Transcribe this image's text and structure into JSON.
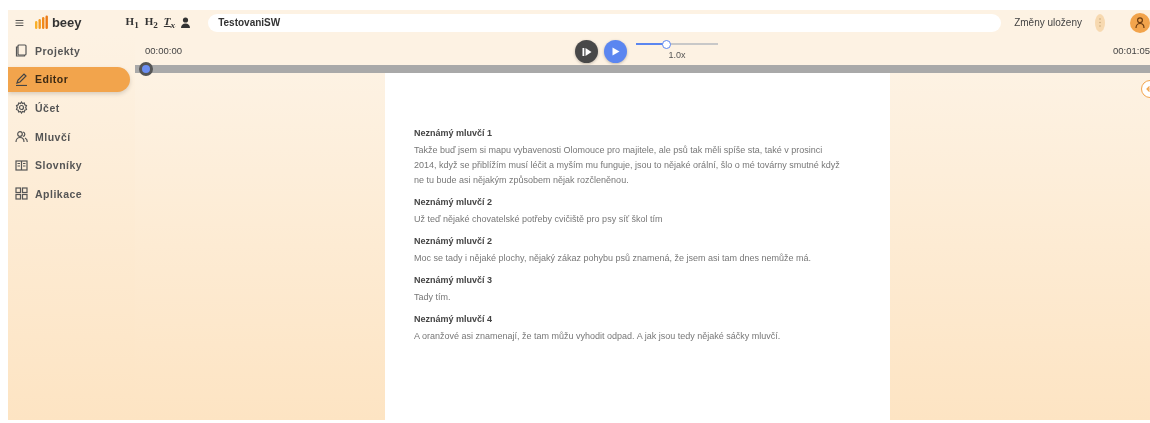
{
  "header": {
    "brand": "beey",
    "tools": [
      "H",
      "H",
      "T"
    ],
    "tool_subs": [
      "1",
      "2",
      "x"
    ],
    "title_value": "TestovaniSW",
    "save_status": "Změny uloženy"
  },
  "sidebar": {
    "items": [
      {
        "label": "Projekty",
        "selected": false
      },
      {
        "label": "Editor",
        "selected": true
      },
      {
        "label": "Účet",
        "selected": false
      },
      {
        "label": "Mluvčí",
        "selected": false
      },
      {
        "label": "Slovníky",
        "selected": false
      },
      {
        "label": "Aplikace",
        "selected": false
      }
    ]
  },
  "player": {
    "current_time": "00:00:00",
    "total_time": "00:01:05",
    "speed": {
      "level": 0.38,
      "reading": "1.0x"
    },
    "timeline": {
      "level": 0
    }
  },
  "transcript": [
    {
      "speaker": "Neznámý mluvčí 1",
      "text": "Takže buď jsem si mapu vybavenosti Olomouce pro majitele, ale psů tak měli spíše sta, také v prosinci 2014, když se přiblížím musí léčit a myším mu funguje, jsou to nějaké orální, šlo o mé továrny smutné když ne tu bude asi nějakým způsobem nějak rozčleněnou."
    },
    {
      "speaker": "Neznámý mluvčí 2",
      "text": "Už teď nějaké chovatelské potřeby cvičiště pro psy síť škol tím"
    },
    {
      "speaker": "Neznámý mluvčí 2",
      "text": "Moc se tady i nějaké plochy, nějaký zákaz pohybu psů znamená, že jsem asi tam dnes nemůže má."
    },
    {
      "speaker": "Neznámý mluvčí 3",
      "text": "Tady tím."
    },
    {
      "speaker": "Neznámý mluvčí 4",
      "text": "A oranžové asi znamenají, že tam můžu vyhodit odpad. A jak jsou tedy nějaké sáčky mluvčí."
    }
  ]
}
